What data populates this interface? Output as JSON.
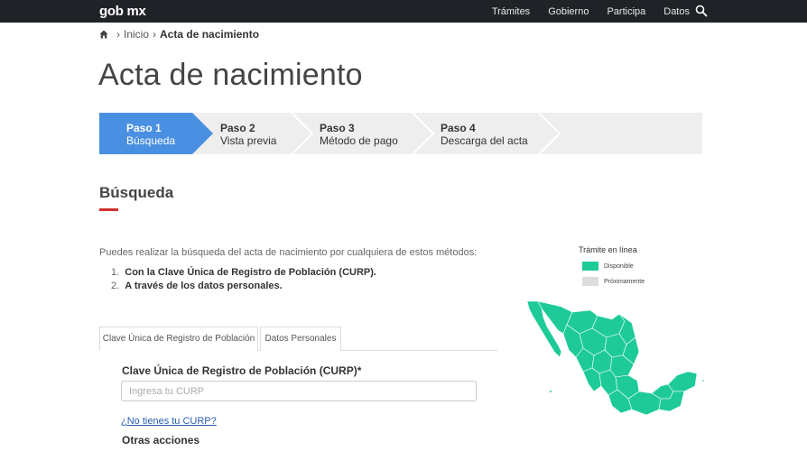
{
  "navbar": {
    "brand": "gob mx",
    "links": [
      "Trámites",
      "Gobierno",
      "Participa",
      "Datos"
    ]
  },
  "breadcrumb": {
    "home": "Inicio",
    "current": "Acta de nacimiento"
  },
  "page": {
    "title": "Acta de nacimiento"
  },
  "stepper": {
    "steps": [
      {
        "title": "Paso 1",
        "subtitle": "Búsqueda",
        "active": true
      },
      {
        "title": "Paso 2",
        "subtitle": "Vista previa",
        "active": false
      },
      {
        "title": "Paso 3",
        "subtitle": "Método de pago",
        "active": false
      },
      {
        "title": "Paso 4",
        "subtitle": "Descarga del acta",
        "active": false
      }
    ]
  },
  "section": {
    "title": "Búsqueda",
    "intro": "Puedes realizar la búsqueda del acta de nacimiento por cualquiera de estos métodos:",
    "methods": [
      {
        "num": "1.",
        "text": "Con la Clave Única de Registro de Población (CURP)."
      },
      {
        "num": "2.",
        "text": "A través de los datos personales."
      }
    ]
  },
  "tabs": {
    "curp": "Clave Única de Registro de Población",
    "datos": "Datos Personales"
  },
  "form": {
    "curp_label": "Clave Única de Registro de Población (CURP)*",
    "curp_placeholder": "Ingresa tu CURP",
    "curp_value": "",
    "no_curp_link": "¿No tienes tu CURP?",
    "other_actions": "Otras acciones"
  },
  "legend": {
    "title": "Trámite en línea",
    "items": [
      {
        "label": "Disponible",
        "color": "#1ecb98"
      },
      {
        "label": "Próximamente",
        "color": "#dddddd"
      }
    ]
  },
  "colors": {
    "navbar": "#1f2226",
    "step_active": "#4a90e2",
    "step_inactive": "#eeeeee",
    "accent_red": "#d32f2f",
    "map_fill": "#1ecb98",
    "link": "#2a5db0"
  }
}
